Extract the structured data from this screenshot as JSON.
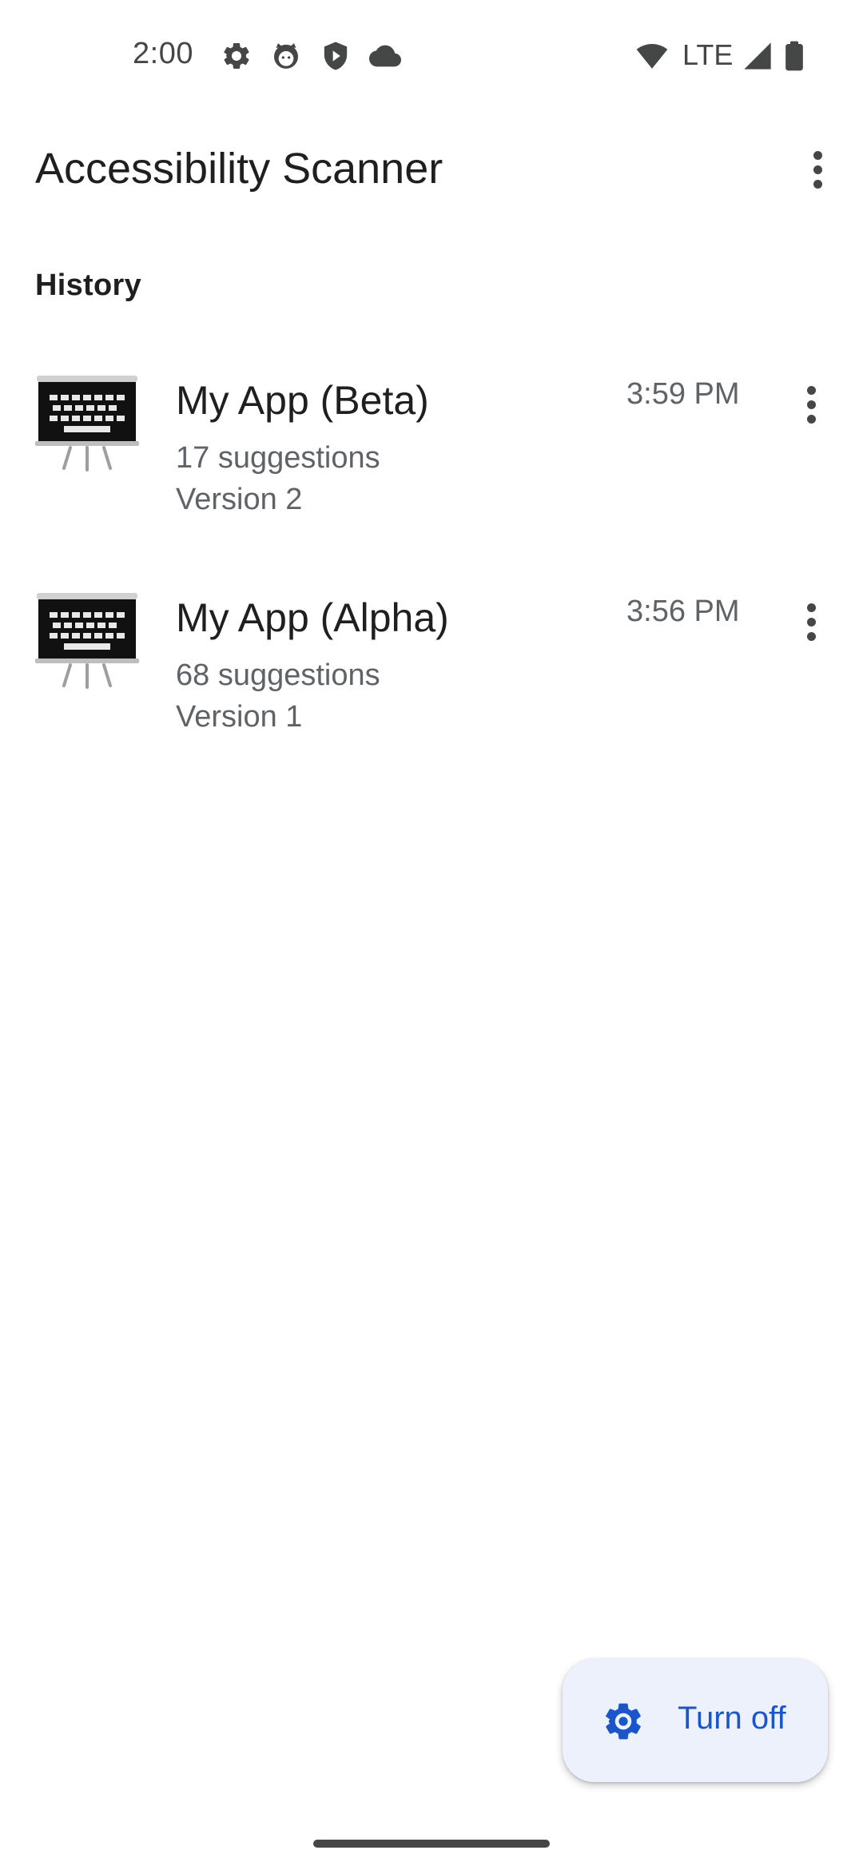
{
  "status_bar": {
    "time": "2:00",
    "network": "LTE",
    "left_icons": [
      "settings-icon",
      "cat-face-icon",
      "shield-play-icon",
      "cloud-icon"
    ],
    "right_icons": [
      "wifi-icon",
      "signal-icon",
      "battery-icon"
    ]
  },
  "app_bar": {
    "title": "Accessibility Scanner",
    "overflow_icon": "more-vert-icon"
  },
  "history": {
    "header": "History",
    "items": [
      {
        "title": "My App (Beta)",
        "suggestions": "17 suggestions",
        "version": "Version 2",
        "time": "3:59 PM",
        "thumbnail_icon": "keyboard-screen-icon"
      },
      {
        "title": "My App (Alpha)",
        "suggestions": "68 suggestions",
        "version": "Version 1",
        "time": "3:56 PM",
        "thumbnail_icon": "keyboard-screen-icon"
      }
    ]
  },
  "fab": {
    "label": "Turn off",
    "icon": "gear-icon"
  },
  "colors": {
    "accent": "#1a55c9",
    "fab_background": "#edf1fb",
    "text_primary": "#1f1f1f",
    "text_secondary": "#5f6368"
  }
}
